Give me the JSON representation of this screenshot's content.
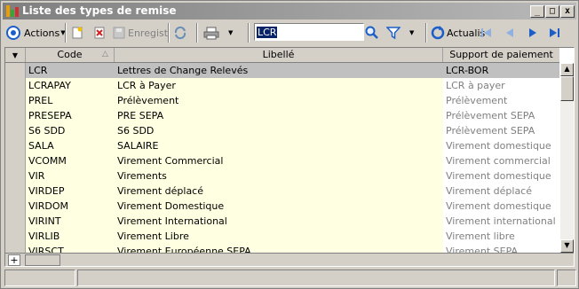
{
  "window": {
    "title": "Liste des types de remise"
  },
  "toolbar": {
    "actions_label": "Actions",
    "save_label": "Enregist",
    "refresh_label": "Actualis",
    "search_value": "LCR"
  },
  "grid": {
    "headers": {
      "code": "Code",
      "libelle": "Libellé",
      "support": "Support de paiement"
    },
    "rows": [
      {
        "code": "LCR",
        "libelle": "Lettres de Change Relevés",
        "support": "LCR-BOR"
      },
      {
        "code": "LCRAPAY",
        "libelle": "LCR à Payer",
        "support": "LCR à payer"
      },
      {
        "code": "PREL",
        "libelle": "Prélèvement",
        "support": "Prélèvement"
      },
      {
        "code": "PRESEPA",
        "libelle": "PRE SEPA",
        "support": "Prélèvement SEPA"
      },
      {
        "code": "S6 SDD",
        "libelle": "S6 SDD",
        "support": "Prélèvement SEPA"
      },
      {
        "code": "SALA",
        "libelle": "SALAIRE",
        "support": "Virement domestique"
      },
      {
        "code": "VCOMM",
        "libelle": "Virement Commercial",
        "support": "Virement commercial"
      },
      {
        "code": "VIR",
        "libelle": "Virements",
        "support": "Virement domestique"
      },
      {
        "code": "VIRDEP",
        "libelle": "Virement déplacé",
        "support": "Virement déplacé"
      },
      {
        "code": "VIRDOM",
        "libelle": "Virement Domestique",
        "support": "Virement domestique"
      },
      {
        "code": "VIRINT",
        "libelle": "Virement International",
        "support": "Virement international"
      },
      {
        "code": "VIRLIB",
        "libelle": "Virement Libre",
        "support": "Virement libre"
      },
      {
        "code": "VIRSCT",
        "libelle": "Virement Européenne SEPA",
        "support": "Virement SEPA"
      }
    ],
    "footer_add": "+"
  },
  "colors": {
    "row_bg": "#ffffe1",
    "selected_bg": "#c0c0c0",
    "support_text": "#808080",
    "toolbar_blue": "#1c5ec9"
  }
}
